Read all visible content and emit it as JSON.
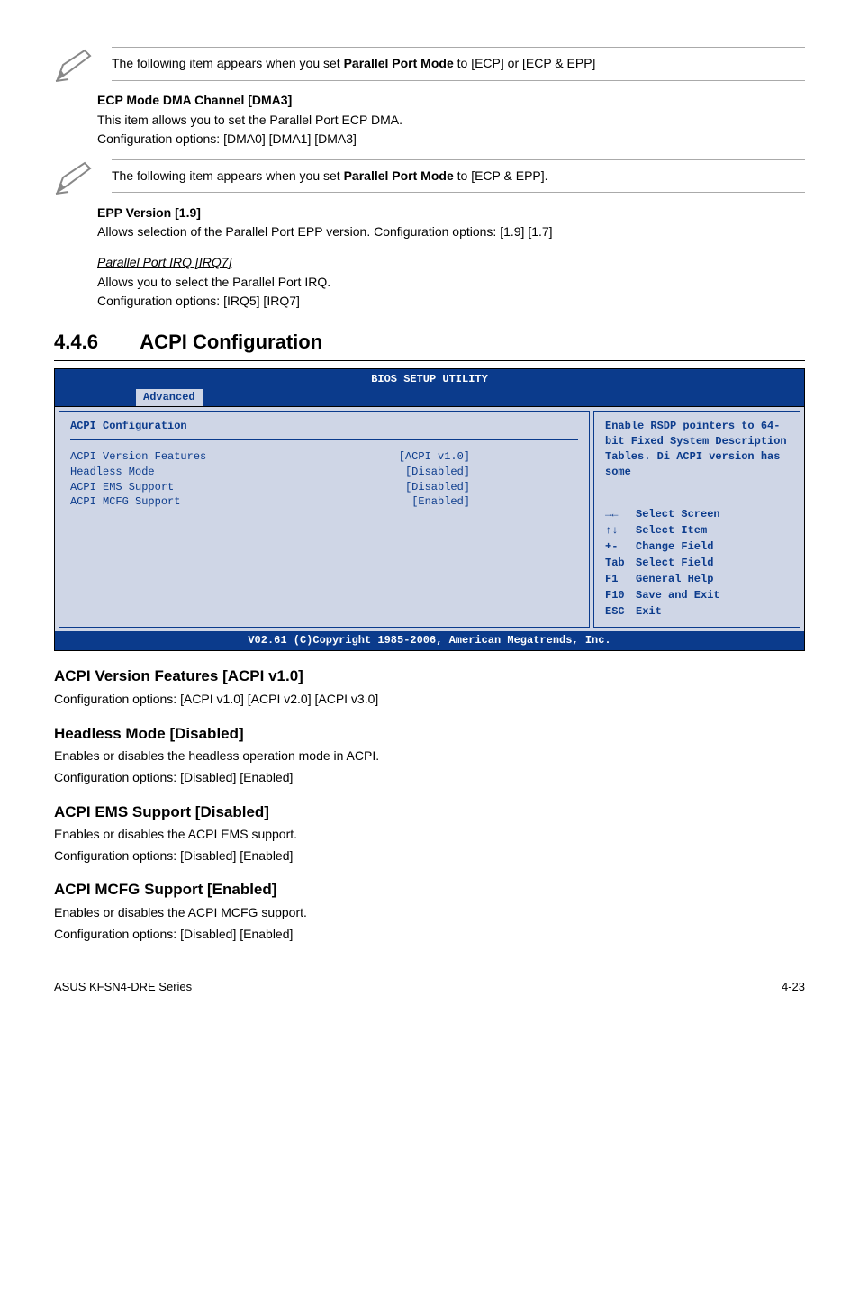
{
  "note1_pre": "The following item appears when you set ",
  "note1_bold": "Parallel Port Mode",
  "note1_post": " to [ECP] or [ECP & EPP]",
  "ecp_head": "ECP Mode DMA Channel [DMA3]",
  "ecp_line1": "This item allows you to set the Parallel Port ECP DMA.",
  "ecp_line2": "Configuration options: [DMA0] [DMA1] [DMA3]",
  "note2_pre": "The following item appears when you set ",
  "note2_bold": "Parallel Port Mode",
  "note2_post": " to [ECP & EPP].",
  "epp_head": "EPP Version [1.9]",
  "epp_line": "Allows selection of the Parallel Port EPP version. Configuration options: [1.9] [1.7]",
  "pp_irq_head": "Parallel Port IRQ [IRQ7]",
  "pp_irq_line1": "Allows you to select the Parallel Port IRQ.",
  "pp_irq_line2": "Configuration options: [IRQ5] [IRQ7]",
  "section_num": "4.4.6",
  "section_title": "ACPI Configuration",
  "bios": {
    "header": "BIOS SETUP UTILITY",
    "tab": "Advanced",
    "cfg_title": "ACPI Configuration",
    "rows": [
      {
        "label": "ACPI Version Features",
        "value": "[ACPI v1.0]"
      },
      {
        "label": "Headless Mode",
        "value": "[Disabled]"
      },
      {
        "label": "ACPI EMS Support",
        "value": "[Disabled]"
      },
      {
        "label": "ACPI MCFG Support",
        "value": "[Enabled]"
      }
    ],
    "help": "Enable RSDP pointers to 64-bit Fixed System Description Tables. Di ACPI version has some",
    "keys": [
      {
        "sym": "→←",
        "label": "Select Screen"
      },
      {
        "sym": "↑↓",
        "label": "Select Item"
      },
      {
        "sym": "+-",
        "label": "Change Field"
      },
      {
        "sym": "Tab",
        "label": "Select Field"
      },
      {
        "sym": "F1",
        "label": "General Help"
      },
      {
        "sym": "F10",
        "label": "Save and Exit"
      },
      {
        "sym": "ESC",
        "label": "Exit"
      }
    ],
    "footer": "V02.61 (C)Copyright 1985-2006, American Megatrends, Inc."
  },
  "s1_head": "ACPI Version Features [ACPI v1.0]",
  "s1_body": "Configuration options: [ACPI v1.0] [ACPI v2.0] [ACPI v3.0]",
  "s2_head": "Headless Mode [Disabled]",
  "s2_body1": "Enables or disables the headless operation mode in ACPI.",
  "s2_body2": "Configuration options: [Disabled] [Enabled]",
  "s3_head": "ACPI EMS Support [Disabled]",
  "s3_body1": "Enables or disables the ACPI EMS support.",
  "s3_body2": "Configuration options: [Disabled] [Enabled]",
  "s4_head": "ACPI MCFG Support [Enabled]",
  "s4_body1": "Enables or disables the ACPI MCFG support.",
  "s4_body2": "Configuration options: [Disabled] [Enabled]",
  "footer_left": "ASUS KFSN4-DRE Series",
  "footer_right": "4-23"
}
